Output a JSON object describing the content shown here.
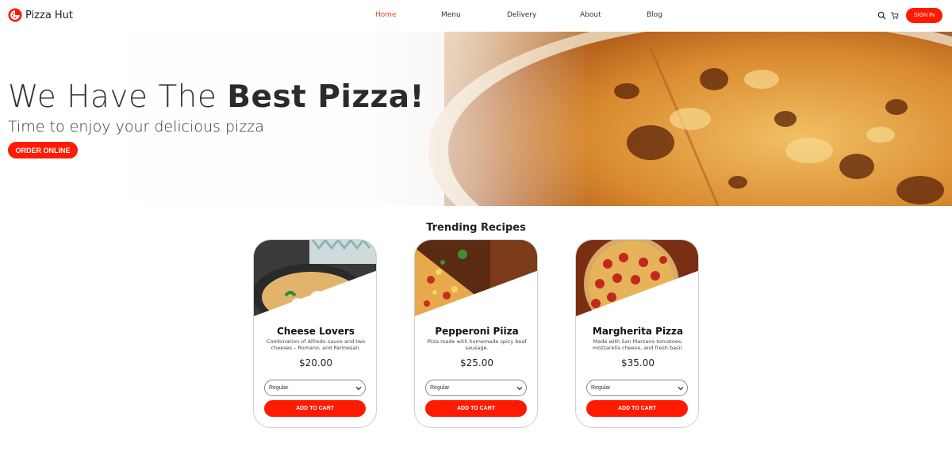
{
  "brand": {
    "name": "Pizza Hut",
    "logo_icon": "pizza-hut-logo-icon",
    "accent": "#ff1a00"
  },
  "nav": {
    "links": [
      {
        "label": "Home",
        "active": true
      },
      {
        "label": "Menu",
        "active": false
      },
      {
        "label": "Delivery",
        "active": false
      },
      {
        "label": "About",
        "active": false
      },
      {
        "label": "Blog",
        "active": false
      }
    ],
    "icons": [
      "search-icon",
      "cart-icon"
    ],
    "signin_label": "SIGN IN"
  },
  "hero": {
    "title_light": "We Have The ",
    "title_bold": "Best Pizza!",
    "subtitle": "Time to enjoy your delicious pizza",
    "cta_label": "ORDER ONLINE"
  },
  "trending": {
    "title": "Trending Recipes",
    "cards": [
      {
        "name": "Cheese Lovers",
        "description": "Combination of Alfredo sauce and two cheeses – Romano, and Parmesan.",
        "price": "$20.00",
        "size_selected": "Regular",
        "cta_label": "ADD TO CART"
      },
      {
        "name": "Pepperoni Piiza",
        "description": "Piiza made with homemade spicy beaf sausage.",
        "price": "$25.00",
        "size_selected": "Regular",
        "cta_label": "ADD TO CART"
      },
      {
        "name": "Margherita Pizza",
        "description": "Made with San Marzano tomatoes, mozzarella cheese, and fresh basil.",
        "price": "$35.00",
        "size_selected": "Regular",
        "cta_label": "ADD TO CART"
      }
    ]
  }
}
